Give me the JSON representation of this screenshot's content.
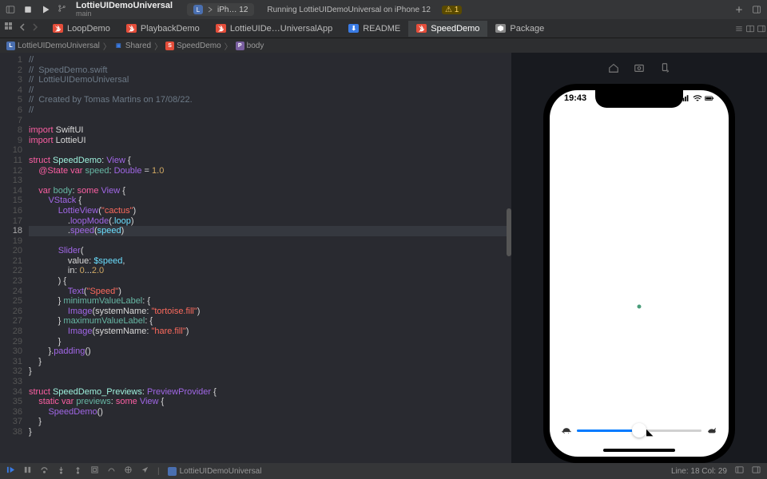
{
  "titlebar": {
    "project_name": "LottieUIDemoUniversal",
    "branch": "main",
    "scheme_app": "L",
    "scheme_device": "iPh… 12",
    "status": "Running LottieUIDemoUniversal on iPhone 12",
    "warning_count": "1"
  },
  "tabs": {
    "items": [
      {
        "label": "LoopDemo",
        "icon": "swift"
      },
      {
        "label": "PlaybackDemo",
        "icon": "swift"
      },
      {
        "label": "LottieUIDe…UniversalApp",
        "icon": "swift"
      },
      {
        "label": "README",
        "icon": "md"
      },
      {
        "label": "SpeedDemo",
        "icon": "swift",
        "active": true
      },
      {
        "label": "Package",
        "icon": "pkg"
      }
    ]
  },
  "breadcrumb": {
    "items": [
      {
        "label": "LottieUIDemoUniversal",
        "kind": "app"
      },
      {
        "label": "Shared",
        "kind": "folder"
      },
      {
        "label": "SpeedDemo",
        "kind": "swift"
      },
      {
        "label": "body",
        "kind": "prop"
      }
    ]
  },
  "editor": {
    "cursor_line": 18,
    "lines": [
      {
        "n": 1,
        "seg": [
          {
            "c": "cm",
            "t": "//"
          }
        ]
      },
      {
        "n": 2,
        "seg": [
          {
            "c": "cm",
            "t": "//  SpeedDemo.swift"
          }
        ]
      },
      {
        "n": 3,
        "seg": [
          {
            "c": "cm",
            "t": "//  LottieUIDemoUniversal"
          }
        ]
      },
      {
        "n": 4,
        "seg": [
          {
            "c": "cm",
            "t": "//"
          }
        ]
      },
      {
        "n": 5,
        "seg": [
          {
            "c": "cm",
            "t": "//  Created by Tomas Martins on 17/08/22."
          }
        ]
      },
      {
        "n": 6,
        "seg": [
          {
            "c": "cm",
            "t": "//"
          }
        ]
      },
      {
        "n": 7,
        "seg": []
      },
      {
        "n": 8,
        "seg": [
          {
            "c": "kw",
            "t": "import"
          },
          {
            "c": "pl",
            "t": " SwiftUI"
          }
        ]
      },
      {
        "n": 9,
        "seg": [
          {
            "c": "kw",
            "t": "import"
          },
          {
            "c": "pl",
            "t": " LottieUI"
          }
        ]
      },
      {
        "n": 10,
        "seg": []
      },
      {
        "n": 11,
        "seg": [
          {
            "c": "kw",
            "t": "struct"
          },
          {
            "c": "pl",
            "t": " "
          },
          {
            "c": "ty",
            "t": "SpeedDemo"
          },
          {
            "c": "pl",
            "t": ": "
          },
          {
            "c": "fn",
            "t": "View"
          },
          {
            "c": "pl",
            "t": " {"
          }
        ]
      },
      {
        "n": 12,
        "seg": [
          {
            "c": "pl",
            "t": "    "
          },
          {
            "c": "kw",
            "t": "@State"
          },
          {
            "c": "pl",
            "t": " "
          },
          {
            "c": "kw",
            "t": "var"
          },
          {
            "c": "pl",
            "t": " "
          },
          {
            "c": "pr",
            "t": "speed"
          },
          {
            "c": "pl",
            "t": ": "
          },
          {
            "c": "fn",
            "t": "Double"
          },
          {
            "c": "pl",
            "t": " = "
          },
          {
            "c": "nm",
            "t": "1.0"
          }
        ]
      },
      {
        "n": 13,
        "seg": []
      },
      {
        "n": 14,
        "seg": [
          {
            "c": "pl",
            "t": "    "
          },
          {
            "c": "kw",
            "t": "var"
          },
          {
            "c": "pl",
            "t": " "
          },
          {
            "c": "pr",
            "t": "body"
          },
          {
            "c": "pl",
            "t": ": "
          },
          {
            "c": "kw",
            "t": "some"
          },
          {
            "c": "pl",
            "t": " "
          },
          {
            "c": "fn",
            "t": "View"
          },
          {
            "c": "pl",
            "t": " {"
          }
        ]
      },
      {
        "n": 15,
        "seg": [
          {
            "c": "pl",
            "t": "        "
          },
          {
            "c": "fn",
            "t": "VStack"
          },
          {
            "c": "pl",
            "t": " {"
          }
        ]
      },
      {
        "n": 16,
        "seg": [
          {
            "c": "pl",
            "t": "            "
          },
          {
            "c": "fn",
            "t": "LottieView"
          },
          {
            "c": "pl",
            "t": "("
          },
          {
            "c": "st",
            "t": "\"cactus\""
          },
          {
            "c": "pl",
            "t": ")"
          }
        ]
      },
      {
        "n": 17,
        "seg": [
          {
            "c": "pl",
            "t": "                ."
          },
          {
            "c": "fn",
            "t": "loopMode"
          },
          {
            "c": "pl",
            "t": "(."
          },
          {
            "c": "vn",
            "t": "loop"
          },
          {
            "c": "pl",
            "t": ")"
          }
        ]
      },
      {
        "n": 18,
        "seg": [
          {
            "c": "pl",
            "t": "                ."
          },
          {
            "c": "fn",
            "t": "speed"
          },
          {
            "c": "pl",
            "t": "("
          },
          {
            "c": "vn",
            "t": "speed"
          },
          {
            "c": "pl",
            "t": ")"
          }
        ],
        "hl": true
      },
      {
        "n": 19,
        "seg": []
      },
      {
        "n": 20,
        "seg": [
          {
            "c": "pl",
            "t": "            "
          },
          {
            "c": "fn",
            "t": "Slider"
          },
          {
            "c": "pl",
            "t": "("
          }
        ]
      },
      {
        "n": 21,
        "seg": [
          {
            "c": "pl",
            "t": "                value: "
          },
          {
            "c": "vn",
            "t": "$speed"
          },
          {
            "c": "pl",
            "t": ","
          }
        ]
      },
      {
        "n": 22,
        "seg": [
          {
            "c": "pl",
            "t": "                in: "
          },
          {
            "c": "nm",
            "t": "0"
          },
          {
            "c": "pl",
            "t": "..."
          },
          {
            "c": "nm",
            "t": "2.0"
          }
        ]
      },
      {
        "n": 23,
        "seg": [
          {
            "c": "pl",
            "t": "            ) {"
          }
        ]
      },
      {
        "n": 24,
        "seg": [
          {
            "c": "pl",
            "t": "                "
          },
          {
            "c": "fn",
            "t": "Text"
          },
          {
            "c": "pl",
            "t": "("
          },
          {
            "c": "st",
            "t": "\"Speed\""
          },
          {
            "c": "pl",
            "t": ")"
          }
        ]
      },
      {
        "n": 25,
        "seg": [
          {
            "c": "pl",
            "t": "            } "
          },
          {
            "c": "pr",
            "t": "minimumValueLabel"
          },
          {
            "c": "pl",
            "t": ": {"
          }
        ]
      },
      {
        "n": 26,
        "seg": [
          {
            "c": "pl",
            "t": "                "
          },
          {
            "c": "fn",
            "t": "Image"
          },
          {
            "c": "pl",
            "t": "(systemName: "
          },
          {
            "c": "st",
            "t": "\"tortoise.fill\""
          },
          {
            "c": "pl",
            "t": ")"
          }
        ]
      },
      {
        "n": 27,
        "seg": [
          {
            "c": "pl",
            "t": "            } "
          },
          {
            "c": "pr",
            "t": "maximumValueLabel"
          },
          {
            "c": "pl",
            "t": ": {"
          }
        ]
      },
      {
        "n": 28,
        "seg": [
          {
            "c": "pl",
            "t": "                "
          },
          {
            "c": "fn",
            "t": "Image"
          },
          {
            "c": "pl",
            "t": "(systemName: "
          },
          {
            "c": "st",
            "t": "\"hare.fill\""
          },
          {
            "c": "pl",
            "t": ")"
          }
        ]
      },
      {
        "n": 29,
        "seg": [
          {
            "c": "pl",
            "t": "            }"
          }
        ]
      },
      {
        "n": 30,
        "seg": [
          {
            "c": "pl",
            "t": "        }."
          },
          {
            "c": "fn",
            "t": "padding"
          },
          {
            "c": "pl",
            "t": "()"
          }
        ]
      },
      {
        "n": 31,
        "seg": [
          {
            "c": "pl",
            "t": "    }"
          }
        ]
      },
      {
        "n": 32,
        "seg": [
          {
            "c": "pl",
            "t": "}"
          }
        ]
      },
      {
        "n": 33,
        "seg": []
      },
      {
        "n": 34,
        "seg": [
          {
            "c": "kw",
            "t": "struct"
          },
          {
            "c": "pl",
            "t": " "
          },
          {
            "c": "ty",
            "t": "SpeedDemo_Previews"
          },
          {
            "c": "pl",
            "t": ": "
          },
          {
            "c": "fn",
            "t": "PreviewProvider"
          },
          {
            "c": "pl",
            "t": " {"
          }
        ]
      },
      {
        "n": 35,
        "seg": [
          {
            "c": "pl",
            "t": "    "
          },
          {
            "c": "kw",
            "t": "static"
          },
          {
            "c": "pl",
            "t": " "
          },
          {
            "c": "kw",
            "t": "var"
          },
          {
            "c": "pl",
            "t": " "
          },
          {
            "c": "pr",
            "t": "previews"
          },
          {
            "c": "pl",
            "t": ": "
          },
          {
            "c": "kw",
            "t": "some"
          },
          {
            "c": "pl",
            "t": " "
          },
          {
            "c": "fn",
            "t": "View"
          },
          {
            "c": "pl",
            "t": " {"
          }
        ]
      },
      {
        "n": 36,
        "seg": [
          {
            "c": "pl",
            "t": "        "
          },
          {
            "c": "fn",
            "t": "SpeedDemo"
          },
          {
            "c": "pl",
            "t": "()"
          }
        ]
      },
      {
        "n": 37,
        "seg": [
          {
            "c": "pl",
            "t": "    }"
          }
        ]
      },
      {
        "n": 38,
        "seg": [
          {
            "c": "pl",
            "t": "}"
          }
        ]
      }
    ]
  },
  "simulator": {
    "time": "19:43",
    "slider_pct": 50
  },
  "bottombar": {
    "file": "LottieUIDemoUniversal",
    "pos": "Line: 18  Col: 29"
  }
}
